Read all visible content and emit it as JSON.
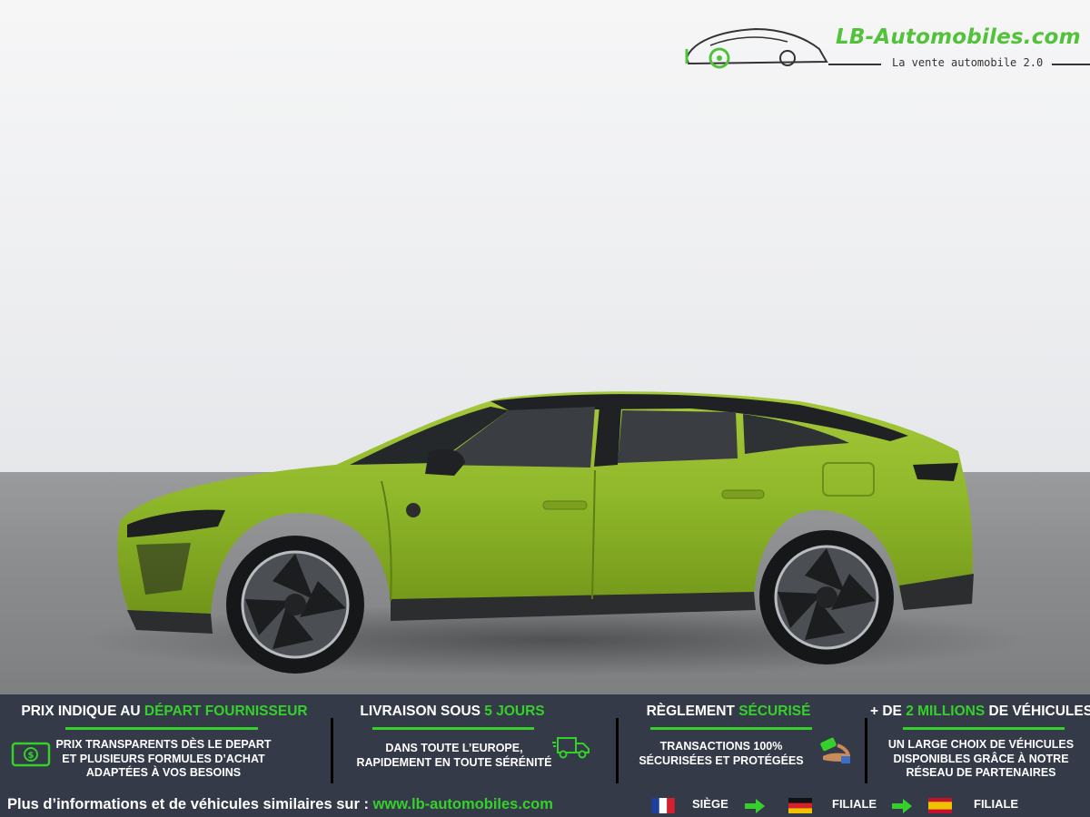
{
  "logo": {
    "title": "LB-Automobiles.com",
    "tagline": "La vente automobile 2.0",
    "accent_color": "#52c23a"
  },
  "vehicle": {
    "body_color": "#8fb82a",
    "badge_icon": "lion-emblem-icon"
  },
  "banner": {
    "background_color": "#353a48",
    "accent_color": "#35d12a",
    "features": [
      {
        "title_pre": "PRIX INDIQUE AU ",
        "title_accent": "DÉPART FOURNISSEUR",
        "title_post": "",
        "lines": [
          "PRIX TRANSPARENTS DÈS LE DEPART",
          "ET PLUSIEURS FORMULES D’ACHAT",
          "ADAPTÉES À VOS BESOINS"
        ],
        "icon": "money-bill-icon"
      },
      {
        "title_pre": "LIVRAISON SOUS ",
        "title_accent": "5 JOURS",
        "title_post": "",
        "lines": [
          "DANS TOUTE L’EUROPE,",
          "RAPIDEMENT EN TOUTE SÉRÉNITÉ"
        ],
        "icon": "delivery-truck-icon"
      },
      {
        "title_pre": "RÈGLEMENT ",
        "title_accent": "SÉCURISÉ",
        "title_post": "",
        "lines": [
          "TRANSACTIONS 100%",
          "SÉCURISÉES ET PROTÉGÉES"
        ],
        "icon": "secure-payment-icon"
      },
      {
        "title_pre": "+ DE ",
        "title_accent": "2 MILLIONS",
        "title_post": " DE VÉHICULES",
        "lines": [
          "UN LARGE CHOIX DE VÉHICULES",
          "DISPONIBLES GRÂCE À NOTRE",
          "RÉSEAU DE PARTENAIRES"
        ],
        "icon": ""
      }
    ],
    "more_info_text": "Plus d’informations et de véhicules similaires sur : ",
    "more_info_url": "www.lb-automobiles.com",
    "locations": [
      {
        "flag": "france-flag-icon",
        "label": "SIÈGE"
      },
      {
        "flag": "germany-flag-icon",
        "label": "FILIALE"
      },
      {
        "flag": "spain-flag-icon",
        "label": "FILIALE"
      }
    ]
  }
}
